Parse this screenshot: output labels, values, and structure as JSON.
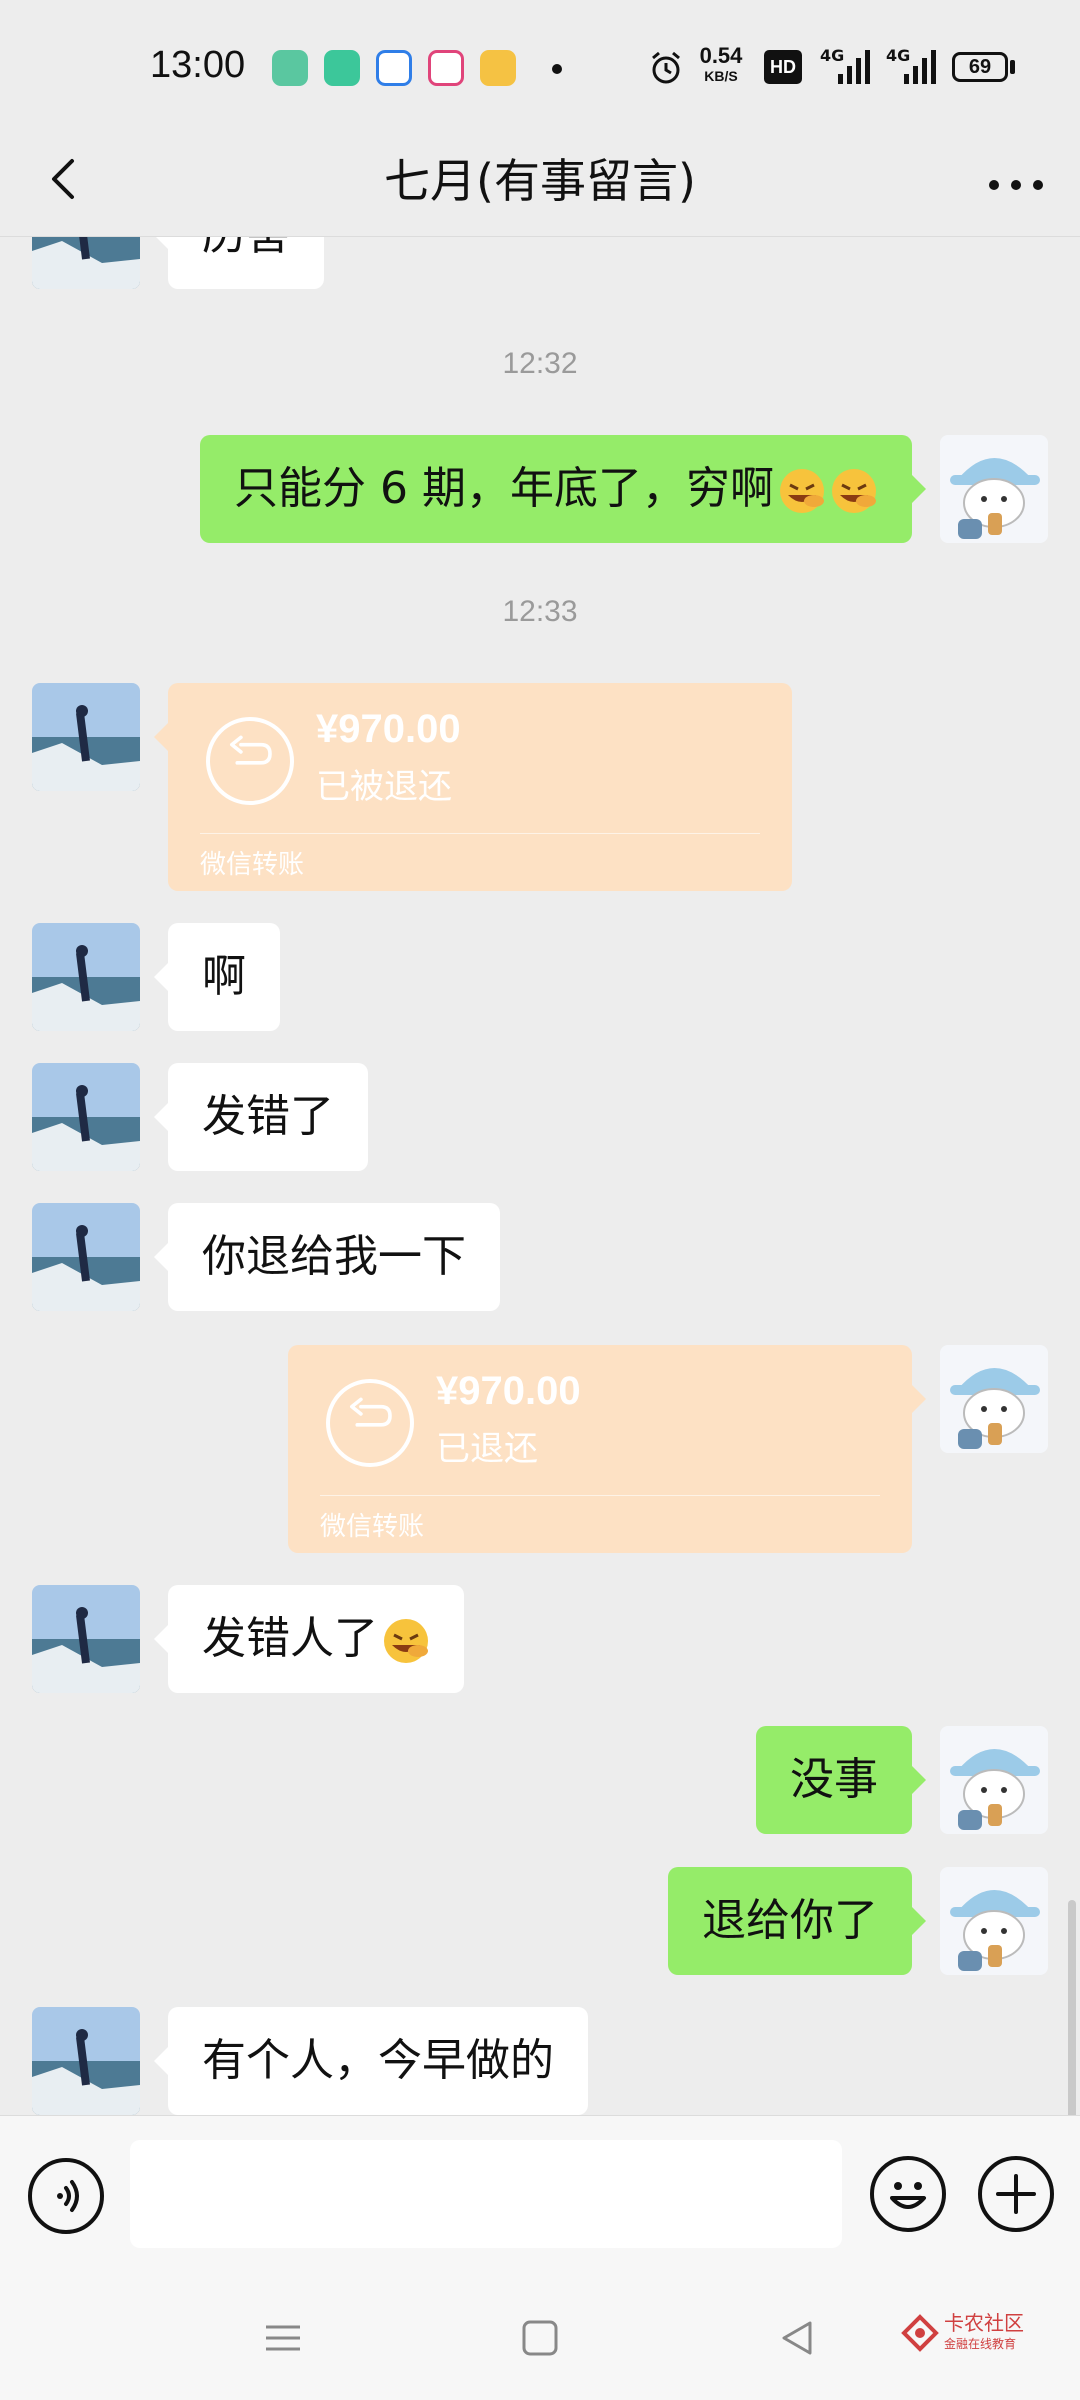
{
  "status_bar": {
    "time": "13:00",
    "network_speed": "0.54",
    "network_unit": "KB/S",
    "hd_label": "HD",
    "signal_labels": [
      "4G",
      "4G"
    ],
    "battery": "69"
  },
  "header": {
    "title": "七月(有事留言)"
  },
  "messages": {
    "m0": "历害",
    "ts1": "12:32",
    "m1": "只能分 6 期，年底了，穷啊",
    "ts2": "12:33",
    "t1_amount": "¥970.00",
    "t1_status": "已被退还",
    "t1_footer": "微信转账",
    "m2": "啊",
    "m3": "发错了",
    "m4": "你退给我一下",
    "t2_amount": "¥970.00",
    "t2_status": "已退还",
    "t2_footer": "微信转账",
    "m5": "发错人了",
    "m6": "没事",
    "m7": "退给你了",
    "m8": "有个人，今早做的"
  },
  "input_bar": {
    "value": ""
  },
  "watermark": {
    "name": "卡农社区",
    "sub": "金融在线教育"
  },
  "colors": {
    "background": "#ededed",
    "green_bubble": "#95ec69",
    "white_bubble": "#ffffff",
    "transfer": "#fde1c4"
  }
}
